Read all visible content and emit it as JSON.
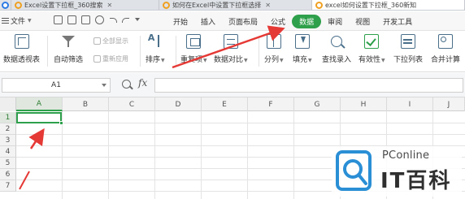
{
  "browser_tabs": [
    {
      "title": "Excel设置下拉框_360搜索",
      "active": false
    },
    {
      "title": "如何在Excel中设置下拉框选择",
      "active": false
    },
    {
      "title": "excel如何设置下拉框_360新知",
      "active": true
    }
  ],
  "menubar": {
    "file_label": "文件",
    "items": [
      "开始",
      "插入",
      "页面布局",
      "公式",
      "数据",
      "审阅",
      "视图",
      "开发工具"
    ],
    "active_item": "数据"
  },
  "ribbon": {
    "pivot_label": "数据透视表",
    "autofilter_label": "自动筛选",
    "show_all_label": "全部显示",
    "reapply_label": "重新应用",
    "sort_label": "排序",
    "duplicates_label": "重复项",
    "compare_label": "数据对比",
    "split_label": "分列",
    "fill_label": "填充",
    "find_label": "查找录入",
    "validation_label": "有效性",
    "dropdown_list_label": "下拉列表",
    "consolidate_label": "合并计算"
  },
  "formula_bar": {
    "name_box": "A1",
    "fx_label": "fx",
    "formula_value": ""
  },
  "grid": {
    "columns": [
      "A",
      "B",
      "C",
      "D",
      "E",
      "F",
      "G",
      "H",
      "I",
      "J"
    ],
    "rows": [
      "1",
      "2",
      "3",
      "4",
      "5",
      "6",
      "7"
    ],
    "selected_cell": "A1"
  },
  "watermark": {
    "top_text": "PConline",
    "bottom_text": "IT百科"
  },
  "colors": {
    "accent_green": "#2e9f4a",
    "annotation_red": "#e53935"
  }
}
